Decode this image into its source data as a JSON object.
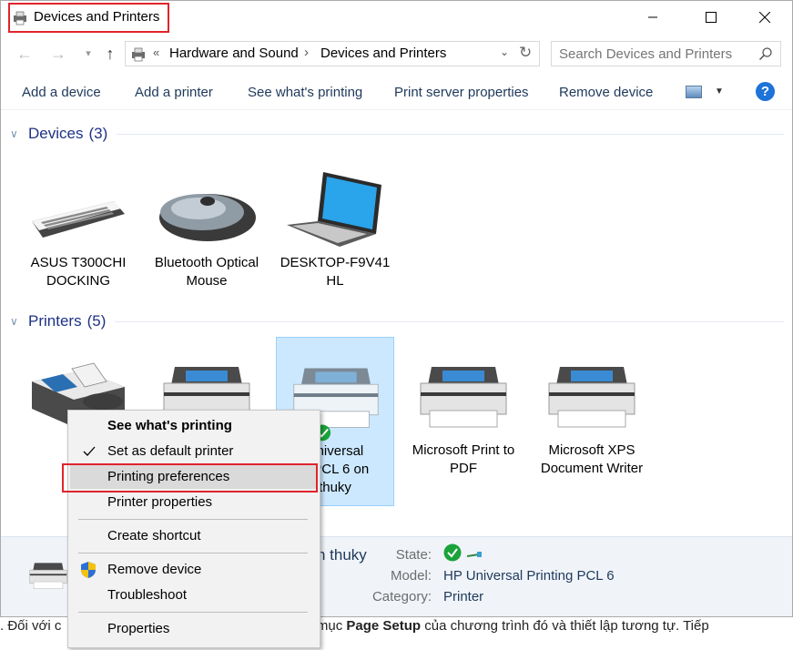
{
  "window": {
    "title": "Devices and Printers",
    "controls": {
      "minimize": "—",
      "maximize": "☐",
      "close": "✕"
    }
  },
  "address": {
    "breadcrumb": [
      "Hardware and Sound",
      "Devices and Printers"
    ],
    "separator": "›",
    "overflow": "«"
  },
  "search": {
    "placeholder": "Search Devices and Printers"
  },
  "toolbar": {
    "commands": [
      "Add a device",
      "Add a printer",
      "See what's printing",
      "Print server properties",
      "Remove device"
    ],
    "help": "?"
  },
  "groups": {
    "devices": {
      "label": "Devices",
      "count": "(3)"
    },
    "printers": {
      "label": "Printers",
      "count": "(5)"
    }
  },
  "devices": [
    {
      "line1": "ASUS T300CHI",
      "line2": "DOCKING",
      "icon": "keyboard-icon"
    },
    {
      "line1": "Bluetooth Optical",
      "line2": "Mouse",
      "icon": "mouse-icon"
    },
    {
      "line1": "DESKTOP-F9V41",
      "line2": "HL",
      "icon": "laptop-icon"
    }
  ],
  "printers": [
    {
      "line1": "",
      "line2": "",
      "icon": "fax-icon"
    },
    {
      "line1": "",
      "line2": "",
      "icon": "printer-icon"
    },
    {
      "line1": "Universal",
      "line2": "g PCL 6 on",
      "line3": "thuky",
      "icon": "printer-icon",
      "default": true
    },
    {
      "line1": "Microsoft Print to",
      "line2": "PDF",
      "icon": "printer-icon"
    },
    {
      "line1": "Microsoft XPS",
      "line2": "Document Writer",
      "icon": "printer-icon"
    }
  ],
  "details": {
    "name": "n thuky",
    "state_label": "State:",
    "model_label": "Model:",
    "model_value": "HP Universal Printing PCL 6",
    "category_label": "Category:",
    "category_value": "Printer"
  },
  "context_menu": {
    "see_printing": "See what's printing",
    "set_default": "Set as default printer",
    "preferences": "Printing preferences",
    "properties_printer": "Printer properties",
    "create_shortcut": "Create shortcut",
    "remove_device": "Remove device",
    "troubleshoot": "Troubleshoot",
    "properties": "Properties"
  },
  "document_line": {
    "p1": ". Đối với c",
    "p2": "n mục ",
    "p3": "Page Setup",
    "p4": " của chương trình đó và thiết lập tương tự. Tiếp"
  },
  "colors": {
    "highlight_border": "#e0242b",
    "accent": "#1e3287",
    "selection": "#cce8ff"
  }
}
